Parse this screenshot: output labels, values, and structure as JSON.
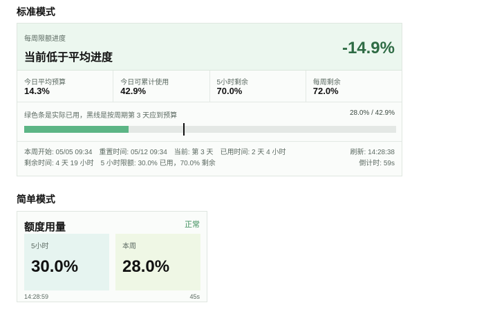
{
  "standard": {
    "section_title": "标准模式",
    "header": {
      "label": "每周限额进度",
      "status": "当前低于平均进度",
      "delta": "-14.9%"
    },
    "metrics": [
      {
        "label": "今日平均预算",
        "value": "14.3%"
      },
      {
        "label": "今日可累计使用",
        "value": "42.9%"
      },
      {
        "label": "5小时剩余",
        "value": "70.0%"
      },
      {
        "label": "每周剩余",
        "value": "72.0%"
      }
    ],
    "bar": {
      "note": "绿色条是实际已用，黑线是按周期第 3 天应到预算",
      "ratio": "28.0% / 42.9%",
      "used_fraction": 0.28,
      "target_fraction": 0.429
    },
    "footer": {
      "row1": [
        "本周开始: 05/05 09:34",
        "重置时间: 05/12 09:34",
        "当前: 第 3 天",
        "已用时间: 2 天 4 小时"
      ],
      "refresh": "刷新: 14:28:38",
      "row2": [
        "剩余时间: 4 天 19 小时",
        "5 小时限额: 30.0% 已用，70.0% 剩余"
      ],
      "countdown": "倒计时: 59s"
    }
  },
  "simple": {
    "section_title": "简单模式",
    "title": "额度用量",
    "status": "正常",
    "tiles": [
      {
        "label": "5小时",
        "value": "30.0%"
      },
      {
        "label": "本周",
        "value": "28.0%"
      }
    ],
    "time": "14:28:59",
    "countdown": "45s"
  },
  "colors": {
    "accent_green": "#5cb585",
    "delta_green": "#2e6b44",
    "status_green": "#3f8f5d"
  }
}
